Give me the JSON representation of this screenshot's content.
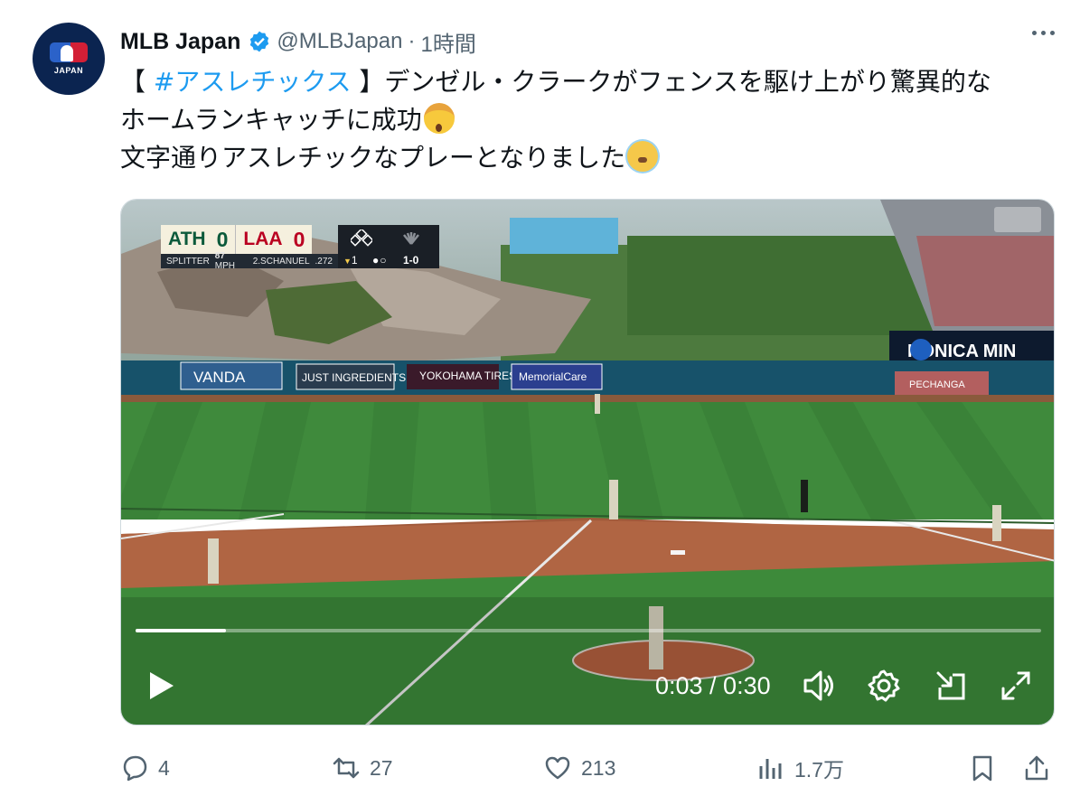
{
  "tweet": {
    "avatar_text": "JAPAN",
    "display_name": "MLB Japan",
    "verified_icon": "verified-badge-icon",
    "handle": "@MLBJapan",
    "separator": "·",
    "time": "1時間",
    "more_icon": "more-icon",
    "text": {
      "line1_open": "【 ",
      "hashtag": "#アスレチックス",
      "line1_rest": " 】デンゼル・クラークがフェンスを駆け上がり驚異的な",
      "line2": "ホームランキャッチに成功",
      "line2_emoji": "exploding-head-emoji",
      "line3": "文字通りアスレチックなプレーとなりました",
      "line3_emoji": "cold-face-emoji"
    },
    "colors": {
      "link": "#1d9bf0",
      "secondary": "#536471",
      "avatar_bg": "#0b2450"
    }
  },
  "video": {
    "scorebug": {
      "away_team": "ATH",
      "away_score": "0",
      "home_team": "LAA",
      "home_score": "0",
      "pitch_type": "SPLITTER",
      "pitch_speed": "87",
      "speed_unit": "MPH",
      "batter": "2.SCHANUEL",
      "batter_avg": ".272",
      "inning_arrow": "▼",
      "inning": "1",
      "outs": "●○",
      "count": "1-0"
    },
    "ads": [
      "VANDA",
      "JUST INGREDIENTS",
      "YOKOHAMA TIRES",
      "MemorialCare",
      "KONICA MIN",
      "PECHANGA"
    ],
    "progress_fraction": 0.1,
    "timecode": "0:03 / 0:30",
    "controls": [
      "play-icon",
      "volume-icon",
      "settings-icon",
      "pip-icon",
      "fullscreen-icon"
    ]
  },
  "actions": {
    "reply_count": "4",
    "retweet_count": "27",
    "like_count": "213",
    "views_count": "1.7万"
  }
}
